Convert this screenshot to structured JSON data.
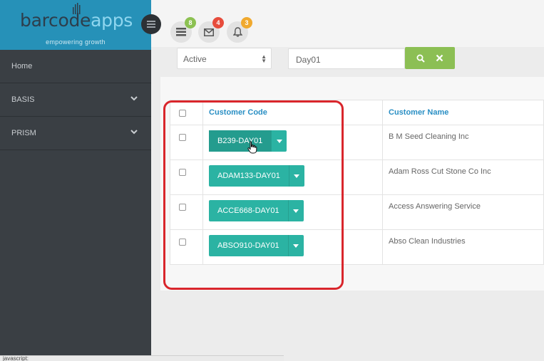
{
  "brand": {
    "logo_barcode": "barcode",
    "logo_apps": "apps",
    "tagline": "empowering growth"
  },
  "sidebar": {
    "items": [
      {
        "label": "Home",
        "has_chevron": false
      },
      {
        "label": "BASIS",
        "has_chevron": true
      },
      {
        "label": "PRISM",
        "has_chevron": true
      }
    ]
  },
  "header": {
    "icons": [
      {
        "name": "list-icon",
        "badge": "8",
        "badge_color": "#8cc152"
      },
      {
        "name": "envelope-icon",
        "badge": "4",
        "badge_color": "#e74c3c"
      },
      {
        "name": "bell-icon",
        "badge": "3",
        "badge_color": "#f0a92e"
      }
    ]
  },
  "filters": {
    "status_value": "Active",
    "search_value": "Day01"
  },
  "table": {
    "headers": {
      "code": "Customer Code",
      "name": "Customer Name"
    },
    "rows": [
      {
        "code": "B239-DAY01",
        "name": "B M Seed Cleaning Inc"
      },
      {
        "code": "ADAM133-DAY01",
        "name": "Adam Ross Cut Stone Co Inc"
      },
      {
        "code": "ACCE668-DAY01",
        "name": "Access Answering Service"
      },
      {
        "code": "ABSO910-DAY01",
        "name": "Abso Clean Industries"
      }
    ]
  },
  "colors": {
    "brand": "#2691b8",
    "sidebar": "#3a3f44",
    "teal_button": "#2bb3a3",
    "search_button": "#8cbf54",
    "header_link": "#2a8fc4",
    "highlight": "#d9262c"
  },
  "statusbar": {
    "text": "javascript:"
  }
}
